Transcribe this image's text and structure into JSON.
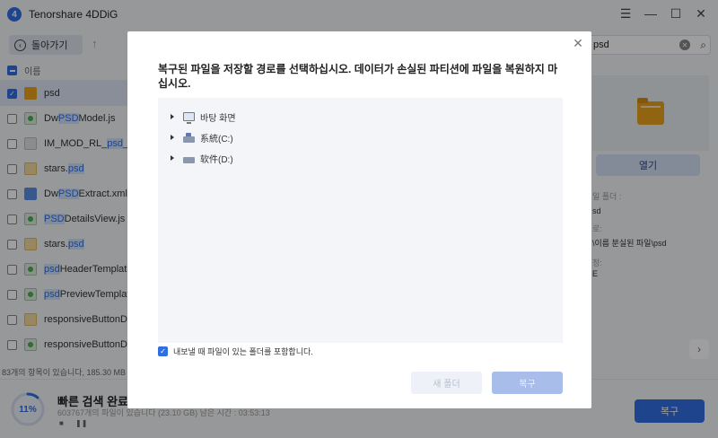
{
  "app": {
    "title": "Tenorshare 4DDiG",
    "logo_letter": "4",
    "back_label": "돌아가기",
    "search_value": "psd"
  },
  "file_list": {
    "header_label": "이름",
    "rows": [
      {
        "pre": "",
        "hl": "",
        "post": "psd",
        "icon": "folder-icon",
        "checked": true
      },
      {
        "pre": "Dw",
        "hl": "PSD",
        "post": "Model.js",
        "icon": "js-file-icon",
        "checked": false
      },
      {
        "pre": "IM_MOD_RL_",
        "hl": "psd",
        "post": "_.dll",
        "icon": "dll-file-icon",
        "checked": false
      },
      {
        "pre": "stars.",
        "hl": "psd",
        "post": "",
        "icon": "image-file-icon",
        "checked": false
      },
      {
        "pre": "Dw",
        "hl": "PSD",
        "post": "Extract.xml",
        "icon": "xml-file-icon",
        "checked": false
      },
      {
        "pre": "",
        "hl": "PSD",
        "post": "DetailsView.js",
        "icon": "js-file-icon",
        "checked": false
      },
      {
        "pre": "stars.",
        "hl": "psd",
        "post": "",
        "icon": "image-file-icon",
        "checked": false
      },
      {
        "pre": "",
        "hl": "psd",
        "post": "HeaderTemplate.h",
        "icon": "js-file-icon",
        "checked": false
      },
      {
        "pre": "",
        "hl": "psd",
        "post": "PreviewTemplate.h",
        "icon": "js-file-icon",
        "checked": false
      },
      {
        "pre": "responsiveButtonDrop",
        "hl": "",
        "post": "",
        "icon": "image-file-icon",
        "checked": false
      },
      {
        "pre": "responsiveButtonDrop",
        "hl": "",
        "post": "",
        "icon": "js-file-icon",
        "checked": false
      }
    ],
    "footer": "83개의 항목이 있습니다, 185.30 MB"
  },
  "preview": {
    "open_label": "열기",
    "details": [
      {
        "text": "일 폴더 :",
        "gray": true
      },
      {
        "text": "sd",
        "gray": false
      },
      {
        "text": "로:",
        "gray": true
      },
      {
        "text": "\\이름 분실된 파일\\psd",
        "gray": false
      },
      {
        "text": "정:",
        "gray": true
      },
      {
        "text": "E",
        "gray": false
      }
    ]
  },
  "scan": {
    "progress_text": "11%",
    "progress": 0.11,
    "title": "빠른 검색 완료!",
    "subtitle": "603767개의 파일이 있습니다 (23.10 GB)  남은 시간 : 03:53:13",
    "recover_label": "복구"
  },
  "dialog": {
    "message": "복구된 파일을 저장할 경로를 선택하십시오. 데이터가 손실된 파티션에 파일을 복원하지 마십시오.",
    "tree": [
      {
        "label": "바탕 화면",
        "icon": "desktop-icon"
      },
      {
        "label": "系統(C:)",
        "icon": "system-drive-icon"
      },
      {
        "label": "软件(D:)",
        "icon": "drive-icon"
      }
    ],
    "include_label": "내보낼 때 파일이 있는 폴더를 포함합니다.",
    "include_checked": true,
    "new_folder_label": "새 폴더",
    "recover_label": "복구"
  },
  "colors": {
    "accent": "#2f6fe4",
    "highlight_bg": "#cfe1fb",
    "disabled_recover": "#a9bdea"
  }
}
